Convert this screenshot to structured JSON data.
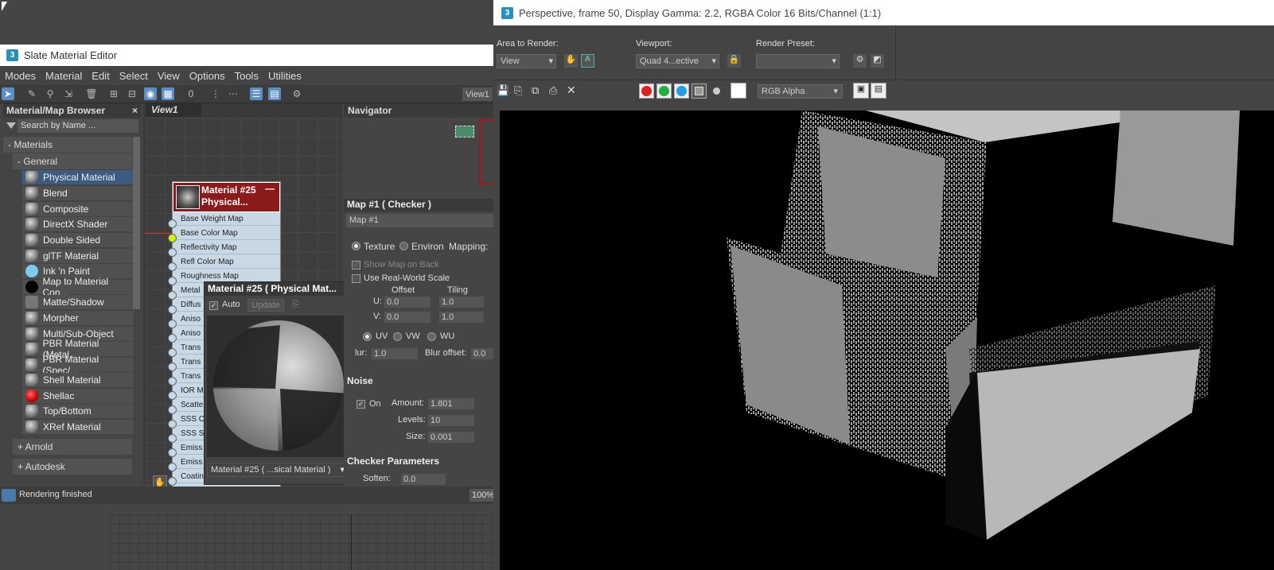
{
  "slate": {
    "title": "Slate Material Editor",
    "app_icon": "3",
    "menu": [
      "Modes",
      "Material",
      "Edit",
      "Select",
      "View",
      "Options",
      "Tools",
      "Utilities"
    ],
    "view_tab": "View1"
  },
  "browser": {
    "title": "Material/Map Browser",
    "search_placeholder": "Search by Name ...",
    "group_materials": "- Materials",
    "group_general": "- General",
    "items": [
      "Physical Material",
      "Blend",
      "Composite",
      "DirectX Shader",
      "Double Sided",
      "glTF Material",
      "Ink 'n Paint",
      "Map to Material Con...",
      "Matte/Shadow",
      "Morpher",
      "Multi/Sub-Object",
      "PBR Material (Metal...",
      "PBR Material (Spec/...",
      "Shell Material",
      "Shellac",
      "Top/Bottom",
      "XRef Material"
    ],
    "group_arnold": "+ Arnold",
    "group_autodesk": "+ Autodesk"
  },
  "view": {
    "tab": "View1",
    "node_title_1": "Material #25",
    "node_title_2": "Physical...",
    "slots": [
      "Base Weight Map",
      "Base Color Map",
      "Reflectivity Map",
      "Refl Color Map",
      "Roughness Map",
      "Metal",
      "Diffus",
      "Aniso",
      "Aniso",
      "Trans",
      "Trans",
      "Trans",
      "IOR M",
      "Scatte",
      "SSS C",
      "SSS S",
      "Emiss",
      "Emiss",
      "Coatin",
      "Coati"
    ]
  },
  "preview": {
    "title": "Material #25  ( Physical Mat...",
    "auto_label": "Auto",
    "update_label": "Update",
    "selector": "Material #25  ( ...sical Material )"
  },
  "navigator": {
    "title": "Navigator"
  },
  "params": {
    "header": "Map #1  ( Checker )",
    "map_name": "Map #1",
    "texture": "Texture",
    "environ": "Environ",
    "mapping": "Mapping:",
    "show_map": "Show Map on Back",
    "real_world": "Use Real-World Scale",
    "offset": "Offset",
    "tiling": "Tiling",
    "u": "U:",
    "v": "V:",
    "u_offset": "0.0",
    "u_tiling": "1.0",
    "v_offset": "0.0",
    "v_tiling": "1.0",
    "uv": "UV",
    "vw": "VW",
    "wu": "WU",
    "blur": "lur:",
    "blur_val": "1.0",
    "blur_offset": "Blur offset:",
    "blur_offset_val": "0.0",
    "noise": "Noise",
    "on": "On",
    "amount": "Amount:",
    "amount_val": "1.801",
    "levels": "Levels:",
    "levels_val": "10",
    "size": "Size:",
    "size_val": "0.001",
    "checker": "Checker Parameters",
    "soften": "Soften:",
    "soften_val": "0.0"
  },
  "status": {
    "text": "Rendering finished",
    "zoom": "100%"
  },
  "framebuffer": {
    "title": "Perspective, frame 50, Display Gamma: 2.2, RGBA Color 16 Bits/Channel (1:1)",
    "area_label": "Area to Render:",
    "area_value": "View",
    "viewport_label": "Viewport:",
    "viewport_value": "Quad 4...ective",
    "preset_label": "Render Preset:",
    "preset_value": "",
    "channel_value": "RGB Alpha"
  },
  "colors": {
    "red": "#e02020",
    "green": "#20b040",
    "blue": "#20a0e0",
    "selection": "#3d5a82",
    "node_header": "#8b1a1a"
  }
}
